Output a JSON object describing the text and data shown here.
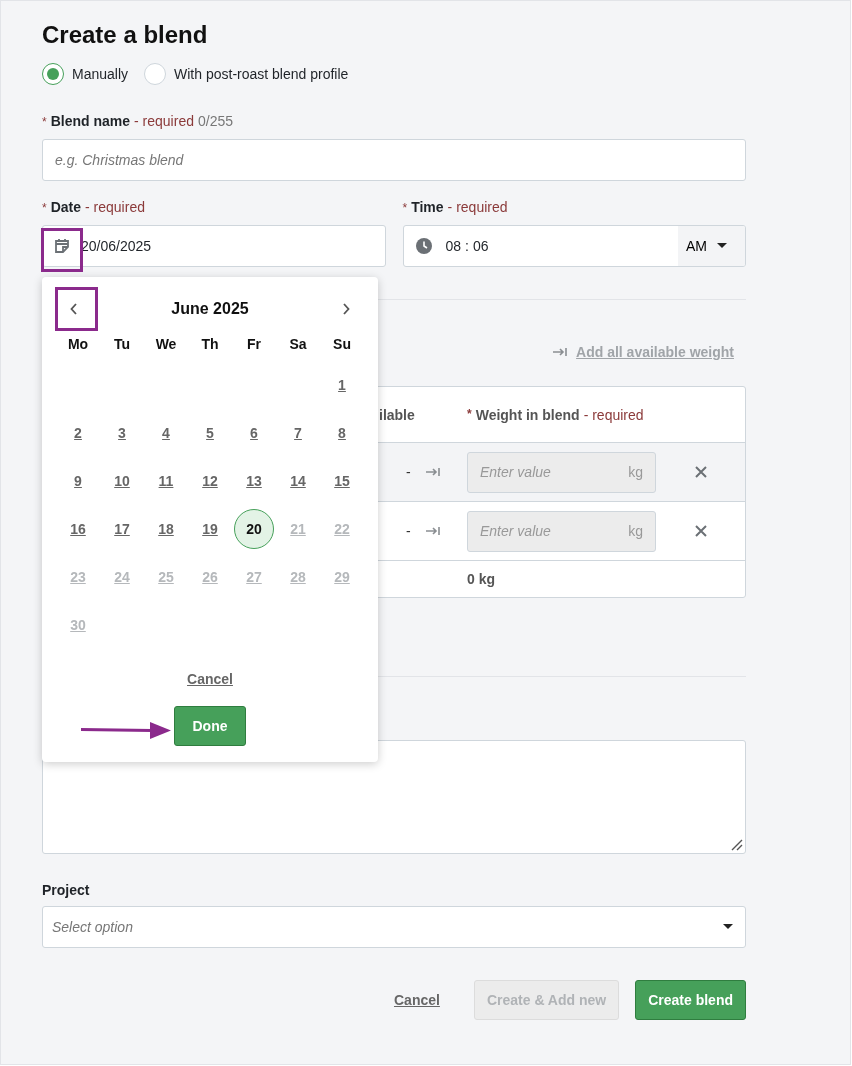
{
  "title": "Create a blend",
  "modes": [
    {
      "label": "Manually",
      "selected": true
    },
    {
      "label": "With post-roast blend profile",
      "selected": false
    }
  ],
  "blend_name": {
    "asterisk": "*",
    "label": "Blend name",
    "required": "- required",
    "counter": "0/255",
    "placeholder": "e.g. Christmas blend"
  },
  "date": {
    "asterisk": "*",
    "label": "Date",
    "required": "- required",
    "value": "20/06/2025"
  },
  "time": {
    "asterisk": "*",
    "label": "Time",
    "required": "- required",
    "hour": "08",
    "separator": ":",
    "minute": "06",
    "period": "AM"
  },
  "add_all_link": "Add all available weight",
  "table": {
    "columns": [
      {
        "label": "ilable"
      },
      {
        "asterisk": "*",
        "label": "Weight in blend",
        "required": "- required"
      }
    ],
    "rows": [
      {
        "available": "-",
        "placeholder": "Enter value",
        "unit": "kg",
        "highlighted": true
      },
      {
        "available": "-",
        "placeholder": "Enter value",
        "unit": "kg",
        "highlighted": false
      }
    ],
    "total": "0 kg"
  },
  "project": {
    "label": "Project",
    "placeholder": "Select option"
  },
  "actions": {
    "cancel": "Cancel",
    "secondary": {
      "label": "Create & Add new",
      "disabled": true
    },
    "primary": {
      "label": "Create blend",
      "disabled": false
    }
  },
  "calendar": {
    "month": "June 2025",
    "weekdays": [
      "Mo",
      "Tu",
      "We",
      "Th",
      "Fr",
      "Sa",
      "Su"
    ],
    "weeks": [
      [
        {
          "kind": "blank"
        },
        {
          "kind": "blank"
        },
        {
          "kind": "blank"
        },
        {
          "kind": "blank"
        },
        {
          "kind": "blank"
        },
        {
          "kind": "blank"
        },
        {
          "kind": "day",
          "day": "1",
          "disabled": false,
          "selected": false
        }
      ],
      [
        {
          "kind": "day",
          "day": "2",
          "disabled": false,
          "selected": false
        },
        {
          "kind": "day",
          "day": "3",
          "disabled": false,
          "selected": false
        },
        {
          "kind": "day",
          "day": "4",
          "disabled": false,
          "selected": false
        },
        {
          "kind": "day",
          "day": "5",
          "disabled": false,
          "selected": false
        },
        {
          "kind": "day",
          "day": "6",
          "disabled": false,
          "selected": false
        },
        {
          "kind": "day",
          "day": "7",
          "disabled": false,
          "selected": false
        },
        {
          "kind": "day",
          "day": "8",
          "disabled": false,
          "selected": false
        }
      ],
      [
        {
          "kind": "day",
          "day": "9",
          "disabled": false,
          "selected": false
        },
        {
          "kind": "day",
          "day": "10",
          "disabled": false,
          "selected": false
        },
        {
          "kind": "day",
          "day": "11",
          "disabled": false,
          "selected": false
        },
        {
          "kind": "day",
          "day": "12",
          "disabled": false,
          "selected": false
        },
        {
          "kind": "day",
          "day": "13",
          "disabled": false,
          "selected": false
        },
        {
          "kind": "day",
          "day": "14",
          "disabled": false,
          "selected": false
        },
        {
          "kind": "day",
          "day": "15",
          "disabled": false,
          "selected": false
        }
      ],
      [
        {
          "kind": "day",
          "day": "16",
          "disabled": false,
          "selected": false
        },
        {
          "kind": "day",
          "day": "17",
          "disabled": false,
          "selected": false
        },
        {
          "kind": "day",
          "day": "18",
          "disabled": false,
          "selected": false
        },
        {
          "kind": "day",
          "day": "19",
          "disabled": false,
          "selected": false
        },
        {
          "kind": "day",
          "day": "20",
          "disabled": false,
          "selected": true
        },
        {
          "kind": "day",
          "day": "21",
          "disabled": true,
          "selected": false
        },
        {
          "kind": "day",
          "day": "22",
          "disabled": true,
          "selected": false
        }
      ],
      [
        {
          "kind": "day",
          "day": "23",
          "disabled": true,
          "selected": false
        },
        {
          "kind": "day",
          "day": "24",
          "disabled": true,
          "selected": false
        },
        {
          "kind": "day",
          "day": "25",
          "disabled": true,
          "selected": false
        },
        {
          "kind": "day",
          "day": "26",
          "disabled": true,
          "selected": false
        },
        {
          "kind": "day",
          "day": "27",
          "disabled": true,
          "selected": false
        },
        {
          "kind": "day",
          "day": "28",
          "disabled": true,
          "selected": false
        },
        {
          "kind": "day",
          "day": "29",
          "disabled": true,
          "selected": false
        }
      ],
      [
        {
          "kind": "day",
          "day": "30",
          "disabled": true,
          "selected": false
        }
      ]
    ],
    "cancel": "Cancel",
    "done": "Done"
  }
}
